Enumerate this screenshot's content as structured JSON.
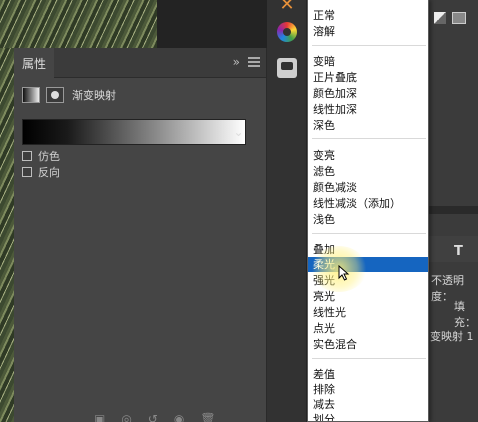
{
  "properties_panel": {
    "tab_title": "属性",
    "collapse_glyph": "»",
    "adjustment_name": "渐变映射",
    "dither_label": "仿色",
    "reverse_label": "反向"
  },
  "blend_modes": {
    "group1": [
      "正常",
      "溶解"
    ],
    "group2": [
      "变暗",
      "正片叠底",
      "颜色加深",
      "线性加深",
      "深色"
    ],
    "group3": [
      "变亮",
      "滤色",
      "颜色减淡",
      "线性减淡（添加）",
      "浅色"
    ],
    "group4": [
      "叠加",
      "柔光",
      "强光",
      "亮光",
      "线性光",
      "点光",
      "实色混合"
    ],
    "group5": [
      "差值",
      "排除",
      "减去",
      "划分"
    ],
    "selected": "柔光"
  },
  "layers_panel": {
    "opacity_label": "不透明度：",
    "fill_label": "填充：",
    "layer_name": "变映射 1",
    "type_icon_glyph": "T"
  },
  "icons": {
    "close": "x-icon",
    "color_wheel": "color-wheel-icon",
    "adjustments": "adjustments-icon"
  },
  "colors": {
    "selection": "#1565c0",
    "panel_bg": "#454545",
    "accent_orange": "#e8913a"
  }
}
